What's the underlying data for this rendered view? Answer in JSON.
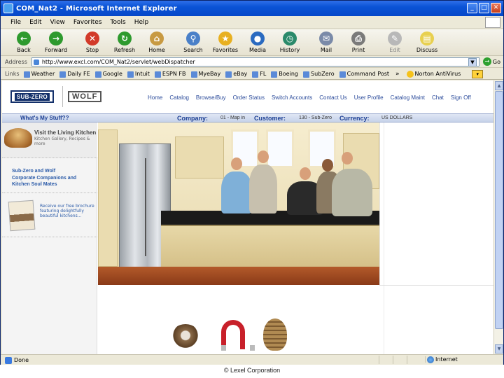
{
  "window": {
    "title": "COM_Nat2 - Microsoft Internet Explorer"
  },
  "menu": [
    "File",
    "Edit",
    "View",
    "Favorites",
    "Tools",
    "Help"
  ],
  "toolbar": [
    {
      "label": "Back",
      "icon": "back-arrow-icon",
      "color": "#2e9a2e",
      "glyph": "←"
    },
    {
      "label": "Forward",
      "icon": "forward-arrow-icon",
      "color": "#2e9a2e",
      "glyph": "→"
    },
    {
      "label": "Stop",
      "icon": "stop-icon",
      "color": "#d23a2a",
      "glyph": "✕"
    },
    {
      "label": "Refresh",
      "icon": "refresh-icon",
      "color": "#2e9a2e",
      "glyph": "↻"
    },
    {
      "label": "Home",
      "icon": "home-icon",
      "color": "#c89a42",
      "glyph": "⌂"
    },
    {
      "label": "Search",
      "icon": "search-icon",
      "color": "#4a80c8",
      "glyph": "⚲"
    },
    {
      "label": "Favorites",
      "icon": "favorites-star-icon",
      "color": "#e8b020",
      "glyph": "★"
    },
    {
      "label": "Media",
      "icon": "media-icon",
      "color": "#2a6ac0",
      "glyph": "●"
    },
    {
      "label": "History",
      "icon": "history-icon",
      "color": "#2a8a6a",
      "glyph": "◷"
    },
    {
      "label": "Mail",
      "icon": "mail-icon",
      "color": "#7a8aa8",
      "glyph": "✉"
    },
    {
      "label": "Print",
      "icon": "print-icon",
      "color": "#7a7a7a",
      "glyph": "⎙"
    },
    {
      "label": "Edit",
      "icon": "edit-icon",
      "color": "#b8b8b8",
      "glyph": "✎",
      "dim": true
    },
    {
      "label": "Discuss",
      "icon": "discuss-icon",
      "color": "#e8d050",
      "glyph": "▤"
    }
  ],
  "address": {
    "label": "Address",
    "url": "http://www.excl.com/COM_Nat2/servlet/webDispatcher",
    "go_label": "Go"
  },
  "links": {
    "label": "Links",
    "items": [
      "Weather",
      "Daily FE",
      "Google",
      "Intuit",
      "ESPN FB",
      "MyeBay",
      "eBay",
      "FL",
      "Boeing",
      "SubZero",
      "Command Post"
    ],
    "norton": "Norton AntiVirus"
  },
  "site": {
    "logo_subzero": "SUB-ZERO",
    "logo_wolf": "WOLF",
    "nav": [
      "Home",
      "Catalog",
      "Browse/Buy",
      "Order Status",
      "Switch Accounts",
      "Contact Us",
      "User Profile",
      "Catalog Maint",
      "Chat",
      "Sign Off"
    ],
    "info": {
      "whats_my_stuff": "What's My Stuff??",
      "company_label": "Company:",
      "company_value": "01 - Map in",
      "customer_label": "Customer:",
      "customer_value": "130 - Sub-Zero",
      "currency_label": "Currency:",
      "currency_value": "US DOLLARS"
    },
    "sidebar": {
      "living_title": "Visit the Living Kitchen",
      "living_sub": "Kitchen Gallery, Recipes & more",
      "companions_title": "Sub-Zero and Wolf",
      "companions_sub": "Corporate Companions and Kitchen Soul Mates",
      "brochure_text": "Receive our free brochure featuring delightfully beautiful kitchens..."
    }
  },
  "status": {
    "text": "Done",
    "zone": "Internet"
  },
  "footer": {
    "copyright": "© Lexel Corporation"
  },
  "colors": {
    "titlebar": "#0a53d6",
    "nav_link": "#2a4a9a",
    "info_key": "#1c3f94"
  }
}
